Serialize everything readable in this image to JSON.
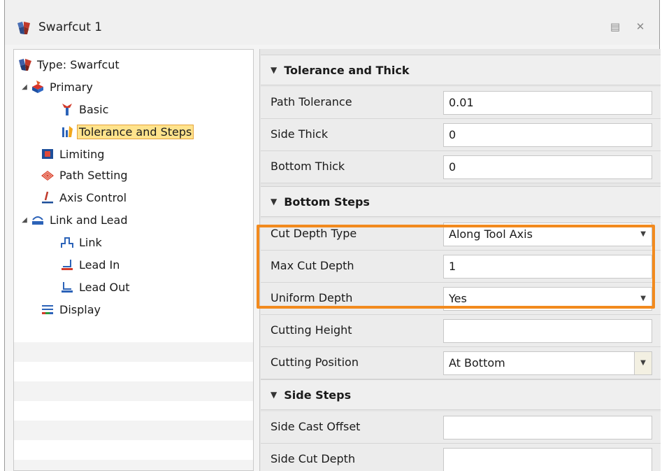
{
  "window": {
    "title": "Swarfcut 1"
  },
  "tree": {
    "items": [
      {
        "label": "Type: Swarfcut",
        "icon": "swarfcut-type-icon"
      },
      {
        "label": "Primary",
        "icon": "primary-icon",
        "expander": "◢"
      },
      {
        "label": "Basic",
        "icon": "basic-tool-icon"
      },
      {
        "label": "Tolerance and Steps",
        "icon": "tolerance-steps-icon",
        "selected": true
      },
      {
        "label": "Limiting",
        "icon": "limiting-icon"
      },
      {
        "label": "Path Setting",
        "icon": "path-setting-icon"
      },
      {
        "label": "Axis Control",
        "icon": "axis-control-icon"
      },
      {
        "label": "Link and Lead",
        "icon": "link-lead-icon",
        "expander": "◢"
      },
      {
        "label": "Link",
        "icon": "link-icon"
      },
      {
        "label": "Lead In",
        "icon": "lead-in-icon"
      },
      {
        "label": "Lead Out",
        "icon": "lead-out-icon"
      },
      {
        "label": "Display",
        "icon": "display-icon"
      }
    ]
  },
  "sections": {
    "tolerance": {
      "title": "Tolerance and Thick",
      "rows": [
        {
          "label": "Path Tolerance",
          "value": "0.01"
        },
        {
          "label": "Side Thick",
          "value": "0"
        },
        {
          "label": "Bottom Thick",
          "value": "0"
        }
      ]
    },
    "bottom_steps": {
      "title": "Bottom Steps",
      "rows": [
        {
          "label": "Cut Depth Type",
          "value": "Along Tool Axis"
        },
        {
          "label": "Max Cut Depth",
          "value": "1"
        },
        {
          "label": "Uniform Depth",
          "value": "Yes"
        },
        {
          "label": "Cutting Height",
          "value": ""
        },
        {
          "label": "Cutting Position",
          "value": "At Bottom"
        }
      ]
    },
    "side_steps": {
      "title": "Side Steps",
      "rows": [
        {
          "label": "Side Cast Offset",
          "value": ""
        },
        {
          "label": "Side Cut Depth",
          "value": ""
        }
      ]
    }
  },
  "colors": {
    "highlight": "#f28a1e",
    "selection": "#ffe38c"
  }
}
